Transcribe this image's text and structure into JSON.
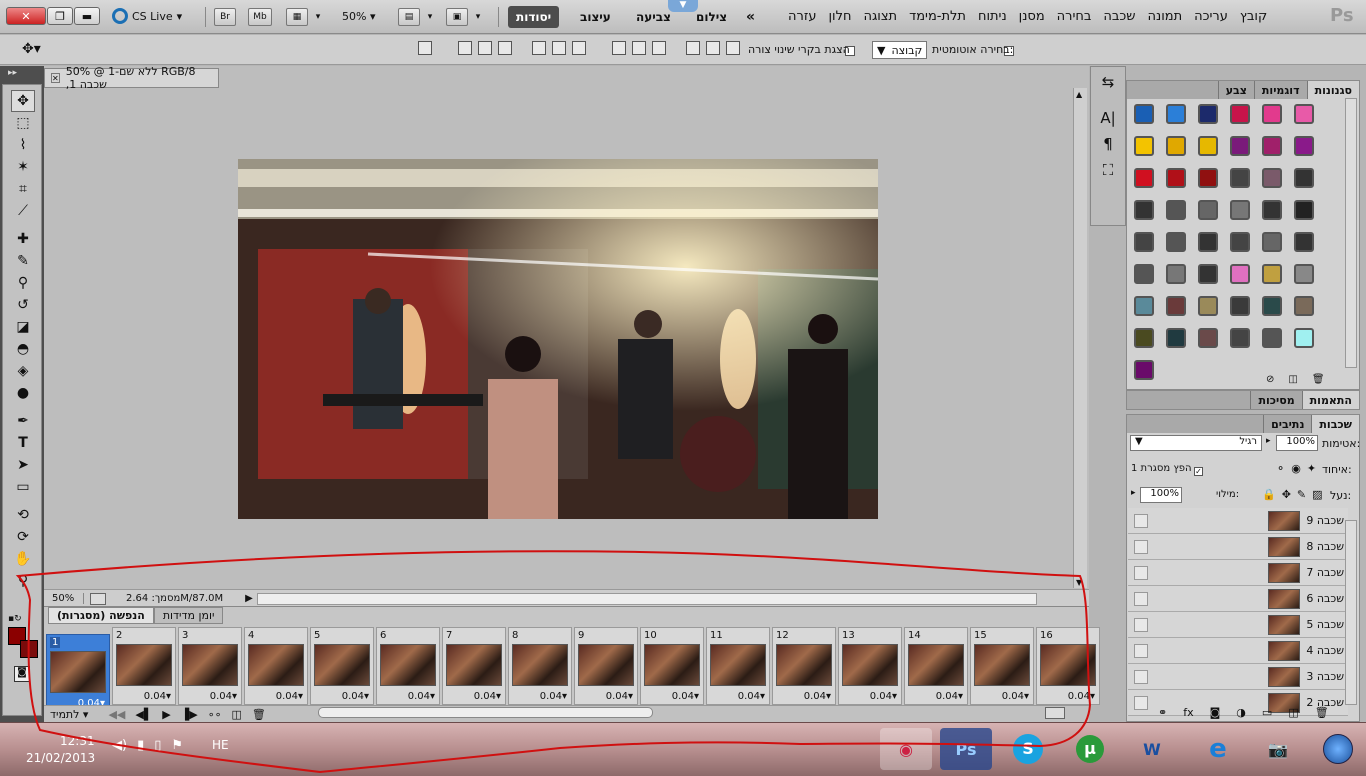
{
  "appbar": {
    "cs_live": "CS Live",
    "br_icon": "Br",
    "mb_icon": "Mb",
    "zoom": "50%",
    "workspaces": [
      "יסודות",
      "עיצוב",
      "צביעה",
      "צילום"
    ],
    "ps_logo": "Ps"
  },
  "menu": [
    "קובץ",
    "עריכה",
    "תמונה",
    "שכבה",
    "בחירה",
    "מסנן",
    "ניתוח",
    "תלת-מימד",
    "תצוגה",
    "חלון",
    "עזרה"
  ],
  "options": {
    "auto_select_label": "בחירה אוטומטית:",
    "auto_select_value": "קבוצה",
    "show_transform": "הצגת בקרי שינוי צורה"
  },
  "document": {
    "tab_title": "ללא שם-1 @ 50% RGB/8 ,שכבה 1",
    "status_zoom": "50%",
    "status_doc": "מסמך: 2.64M/87.0M"
  },
  "animation": {
    "tabs": [
      "הנפשה (מסגרות)",
      "יומן מדידות"
    ],
    "frames": [
      {
        "n": "1",
        "d": "0.04"
      },
      {
        "n": "2",
        "d": "0.04"
      },
      {
        "n": "3",
        "d": "0.04"
      },
      {
        "n": "4",
        "d": "0.04"
      },
      {
        "n": "5",
        "d": "0.04"
      },
      {
        "n": "6",
        "d": "0.04"
      },
      {
        "n": "7",
        "d": "0.04"
      },
      {
        "n": "8",
        "d": "0.04"
      },
      {
        "n": "9",
        "d": "0.04"
      },
      {
        "n": "10",
        "d": "0.04"
      },
      {
        "n": "11",
        "d": "0.04"
      },
      {
        "n": "12",
        "d": "0.04"
      },
      {
        "n": "13",
        "d": "0.04"
      },
      {
        "n": "14",
        "d": "0.04"
      },
      {
        "n": "15",
        "d": "0.04"
      },
      {
        "n": "16",
        "d": "0.04"
      }
    ],
    "loop": "לתמיד"
  },
  "swatch_panel": {
    "tabs": [
      "סגנונות",
      "דוגמיות",
      "צבע"
    ]
  },
  "swatches": [
    "#1a5fb4",
    "#2b7fd8",
    "#1c2a6b",
    "#c8144a",
    "#e23a8d",
    "#e85aa8",
    "#f3c300",
    "#e0a800",
    "#e6b800",
    "#7a1a7a",
    "#a0206a",
    "#8a1a8a",
    "#d01020",
    "#b01018",
    "#901010",
    "#444444",
    "#7a5a6a",
    "#333333",
    "#333333",
    "#555555",
    "#666666",
    "#777777",
    "#333333",
    "#222222",
    "#444444",
    "#555555",
    "#333333",
    "#444444",
    "#666666",
    "#333333",
    "#555555",
    "#777777",
    "#333333",
    "#e070c0",
    "#c0a040",
    "#888888",
    "#5a8a9a",
    "#6a3a3a",
    "#9a8a5a",
    "#3a3a3a",
    "#2a4a4a",
    "#7a6a5a",
    "#4a4a20",
    "#203a40",
    "#6a4a4a",
    "#444444",
    "#555555",
    "#a0f0f0",
    "#6a0a6a"
  ],
  "adjust_panel": {
    "tabs": [
      "התאמות",
      "מסיכות"
    ]
  },
  "layers_panel": {
    "tabs": [
      "שכבות",
      "נתיבים"
    ],
    "blend": "רגיל",
    "opacity_label": "אטימות:",
    "opacity": "100%",
    "unify_label": "איחוד:",
    "propagate": "הפץ מסגרת 1",
    "lock_label": "נעל:",
    "fill_label": "מילוי:",
    "fill": "100%",
    "layers": [
      "שכבה 9",
      "שכבה 8",
      "שכבה 7",
      "שכבה 6",
      "שכבה 5",
      "שכבה 4",
      "שכבה 3",
      "שכבה 2"
    ]
  },
  "taskbar": {
    "time": "12:31",
    "date": "21/02/2013",
    "lang": "HE",
    "ps_btn": "Ps",
    "word_btn": "W"
  }
}
